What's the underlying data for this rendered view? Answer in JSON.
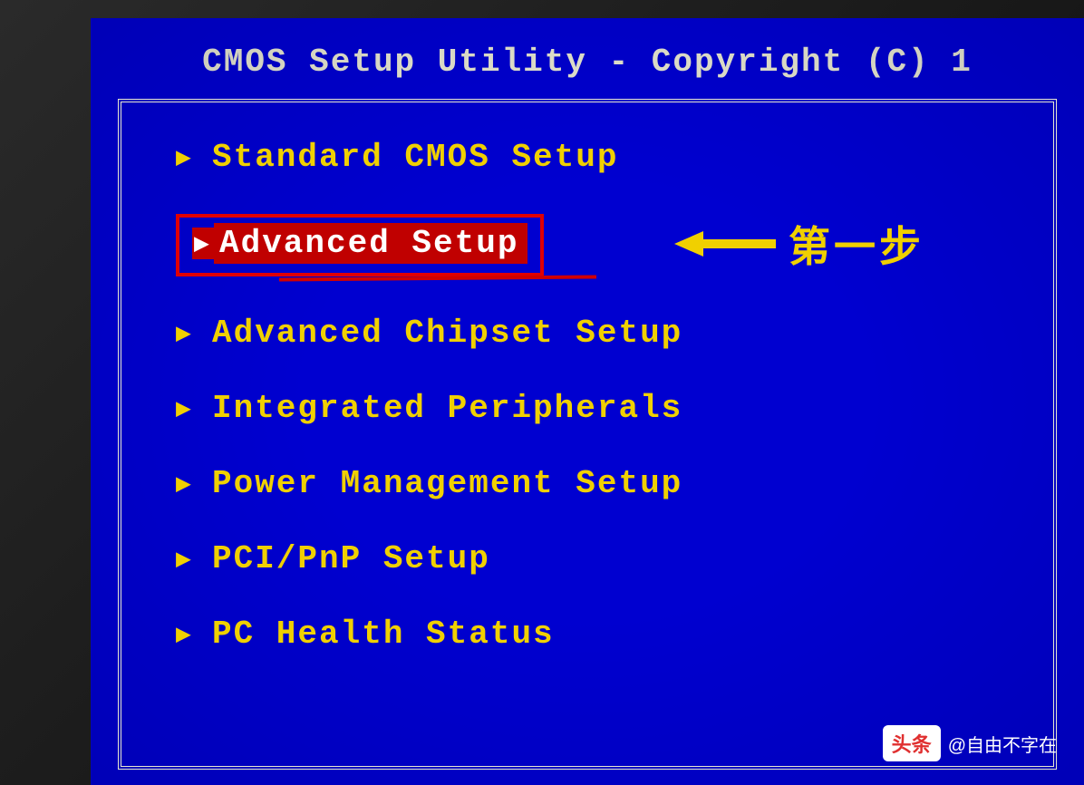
{
  "title": "CMOS Setup Utility - Copyright (C) 1",
  "menu": {
    "items": [
      {
        "label": "Standard CMOS Setup",
        "selected": false
      },
      {
        "label": "Advanced Setup",
        "selected": true
      },
      {
        "label": "Advanced Chipset Setup",
        "selected": false
      },
      {
        "label": "Integrated Peripherals",
        "selected": false
      },
      {
        "label": "Power Management Setup",
        "selected": false
      },
      {
        "label": "PCI/PnP Setup",
        "selected": false
      },
      {
        "label": "PC Health Status",
        "selected": false
      }
    ]
  },
  "annotation": {
    "text": "第一步"
  },
  "watermark": {
    "logo": "头条",
    "author": "@自由不字在"
  },
  "colors": {
    "background": "#0000d0",
    "text": "#f0d000",
    "frame": "#e8e8d0",
    "highlight_bg": "#c00000",
    "highlight_text": "#ffffff",
    "annotation_box": "#e00000"
  }
}
